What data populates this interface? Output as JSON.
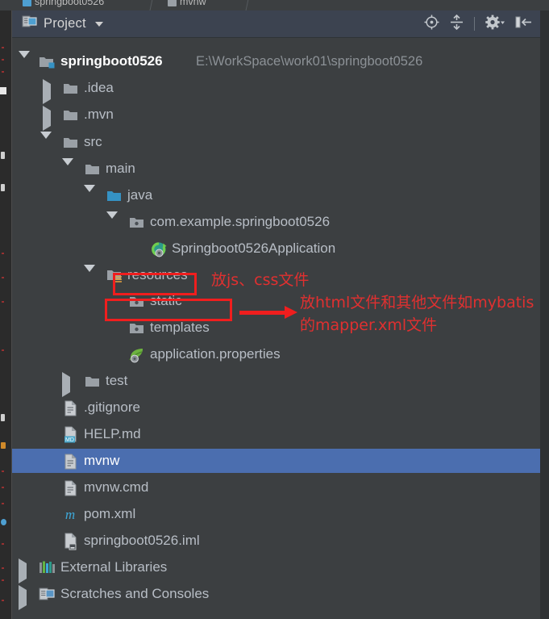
{
  "window": {
    "tabs": [
      {
        "label": "springboot0526",
        "icon": "module-icon"
      },
      {
        "label": "mvnw",
        "icon": "file-icon"
      }
    ]
  },
  "panel": {
    "title": "Project",
    "icon": "project-view-icon",
    "dropdown_icon": "chevron-down-icon",
    "toolbar": [
      {
        "name": "locate-file-icon",
        "tooltip": "Select Opened File"
      },
      {
        "name": "collapse-all-icon",
        "tooltip": "Collapse All"
      },
      {
        "name": "settings-gear-icon",
        "tooltip": "Settings"
      },
      {
        "name": "hide-panel-icon",
        "tooltip": "Hide"
      }
    ]
  },
  "colors": {
    "panel_bg": "#3c3f41",
    "header_bg": "#3c4350",
    "selection": "#4b6eaf",
    "text": "#b8bec6",
    "root_text": "#ffffff",
    "path_text": "#8c9196",
    "annotation_red": "#e03030",
    "box_red": "#f01e1e",
    "folder_gray": "#9aa0a6",
    "source_blue": "#3592c4",
    "maven_cyan": "#3ea8d8",
    "spring_green": "#6db33f"
  },
  "tree": [
    {
      "label": "springboot0526",
      "secondary": "E:\\WorkSpace\\work01\\springboot0526",
      "depth": 0,
      "icon": "module-folder-icon",
      "state": "expanded",
      "bold": true
    },
    {
      "label": ".idea",
      "secondary": "",
      "depth": 1,
      "icon": "folder-icon",
      "state": "collapsed",
      "bold": false
    },
    {
      "label": ".mvn",
      "secondary": "",
      "depth": 1,
      "icon": "folder-icon",
      "state": "collapsed",
      "bold": false
    },
    {
      "label": "src",
      "secondary": "",
      "depth": 1,
      "icon": "folder-icon",
      "state": "expanded",
      "bold": false
    },
    {
      "label": "main",
      "secondary": "",
      "depth": 2,
      "icon": "folder-icon",
      "state": "expanded",
      "bold": false
    },
    {
      "label": "java",
      "secondary": "",
      "depth": 3,
      "icon": "source-root-icon",
      "state": "expanded",
      "bold": false
    },
    {
      "label": "com.example.springboot0526",
      "secondary": "",
      "depth": 4,
      "icon": "package-icon",
      "state": "expanded",
      "bold": false
    },
    {
      "label": "Springboot0526Application",
      "secondary": "",
      "depth": 5,
      "icon": "spring-boot-class-icon",
      "state": "leaf",
      "bold": false
    },
    {
      "label": "resources",
      "secondary": "",
      "depth": 3,
      "icon": "resource-root-icon",
      "state": "expanded",
      "bold": false
    },
    {
      "label": "static",
      "secondary": "",
      "depth": 4,
      "icon": "package-icon",
      "state": "leaf",
      "bold": false
    },
    {
      "label": "templates",
      "secondary": "",
      "depth": 4,
      "icon": "package-icon",
      "state": "leaf",
      "bold": false
    },
    {
      "label": "application.properties",
      "secondary": "",
      "depth": 4,
      "icon": "spring-properties-icon",
      "state": "leaf",
      "bold": false
    },
    {
      "label": "test",
      "secondary": "",
      "depth": 2,
      "icon": "folder-icon",
      "state": "collapsed",
      "bold": false
    },
    {
      "label": ".gitignore",
      "secondary": "",
      "depth": 1,
      "icon": "file-icon",
      "state": "leaf",
      "bold": false
    },
    {
      "label": "HELP.md",
      "secondary": "",
      "depth": 1,
      "icon": "markdown-file-icon",
      "state": "leaf",
      "bold": false
    },
    {
      "label": "mvnw",
      "secondary": "",
      "depth": 1,
      "icon": "file-icon",
      "state": "leaf",
      "bold": false,
      "selected": true
    },
    {
      "label": "mvnw.cmd",
      "secondary": "",
      "depth": 1,
      "icon": "file-icon",
      "state": "leaf",
      "bold": false
    },
    {
      "label": "pom.xml",
      "secondary": "",
      "depth": 1,
      "icon": "maven-file-icon",
      "state": "leaf",
      "bold": false
    },
    {
      "label": "springboot0526.iml",
      "secondary": "",
      "depth": 1,
      "icon": "iml-file-icon",
      "state": "leaf",
      "bold": false
    },
    {
      "label": "External Libraries",
      "secondary": "",
      "depth": 0,
      "icon": "libraries-icon",
      "state": "collapsed",
      "bold": false
    },
    {
      "label": "Scratches and Consoles",
      "secondary": "",
      "depth": 0,
      "icon": "scratches-icon",
      "state": "collapsed",
      "bold": false
    }
  ],
  "annotations": {
    "line1": "放js、css文件",
    "line2": "放html文件和其他文件如mybatis",
    "line3": "的mapper.xml文件",
    "boxes": [
      {
        "target": "static"
      },
      {
        "target": "templates"
      }
    ],
    "arrow": {
      "from": "templates-box",
      "to": "annotation-line2"
    }
  }
}
